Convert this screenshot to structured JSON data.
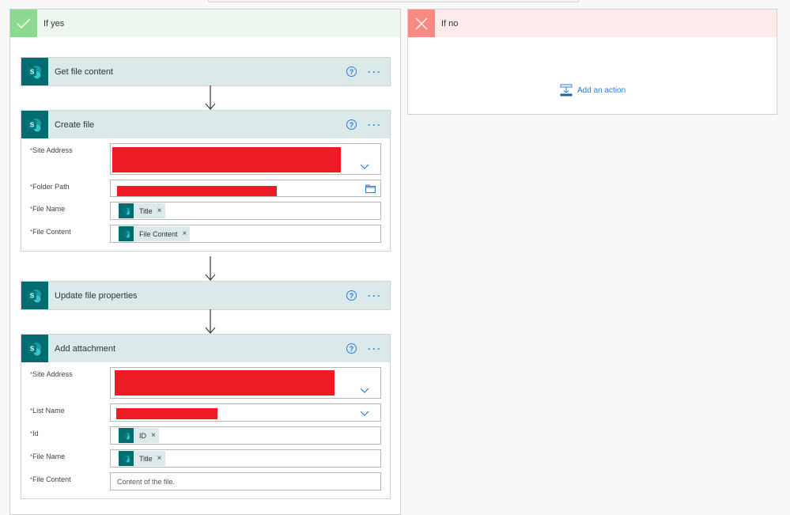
{
  "branches": {
    "yes": {
      "title": "If yes",
      "icon": "checkmark-icon",
      "accent": "#8cda8f",
      "header_bg": "#edf7ee"
    },
    "no": {
      "title": "If no",
      "icon": "close-icon",
      "accent": "#f88a84",
      "header_bg": "#fdeaea",
      "add_action_label": "Add an action"
    }
  },
  "actions": [
    {
      "title": "Get file content",
      "connector": "sharepoint-icon"
    },
    {
      "title": "Create file",
      "connector": "sharepoint-icon",
      "fields": [
        {
          "label": "Site Address",
          "required": true,
          "value": "[redacted]",
          "control": "dropdown"
        },
        {
          "label": "Folder Path",
          "required": true,
          "value": "[redacted]",
          "control": "folder-picker"
        },
        {
          "label": "File Name",
          "required": true,
          "token": "Title"
        },
        {
          "label": "File Content",
          "required": true,
          "token": "File Content"
        }
      ]
    },
    {
      "title": "Update file properties",
      "connector": "sharepoint-icon"
    },
    {
      "title": "Add attachment",
      "connector": "sharepoint-icon",
      "fields": [
        {
          "label": "Site Address",
          "required": true,
          "value": "[redacted]",
          "control": "dropdown"
        },
        {
          "label": "List Name",
          "required": true,
          "value": "[redacted]",
          "control": "dropdown"
        },
        {
          "label": "Id",
          "required": true,
          "token": "ID"
        },
        {
          "label": "File Name",
          "required": true,
          "token": "Title"
        },
        {
          "label": "File Content",
          "required": true,
          "placeholder": "Content of the file."
        }
      ]
    }
  ],
  "colors": {
    "sharepoint": "#036c70",
    "action_header": "#dbe9ea",
    "link": "#2b7cd3",
    "redaction": "#ed1c24",
    "required": "#e0392b"
  },
  "required_marker": "*",
  "token_remove": "×",
  "help_glyph": "?",
  "more_glyph": "···"
}
